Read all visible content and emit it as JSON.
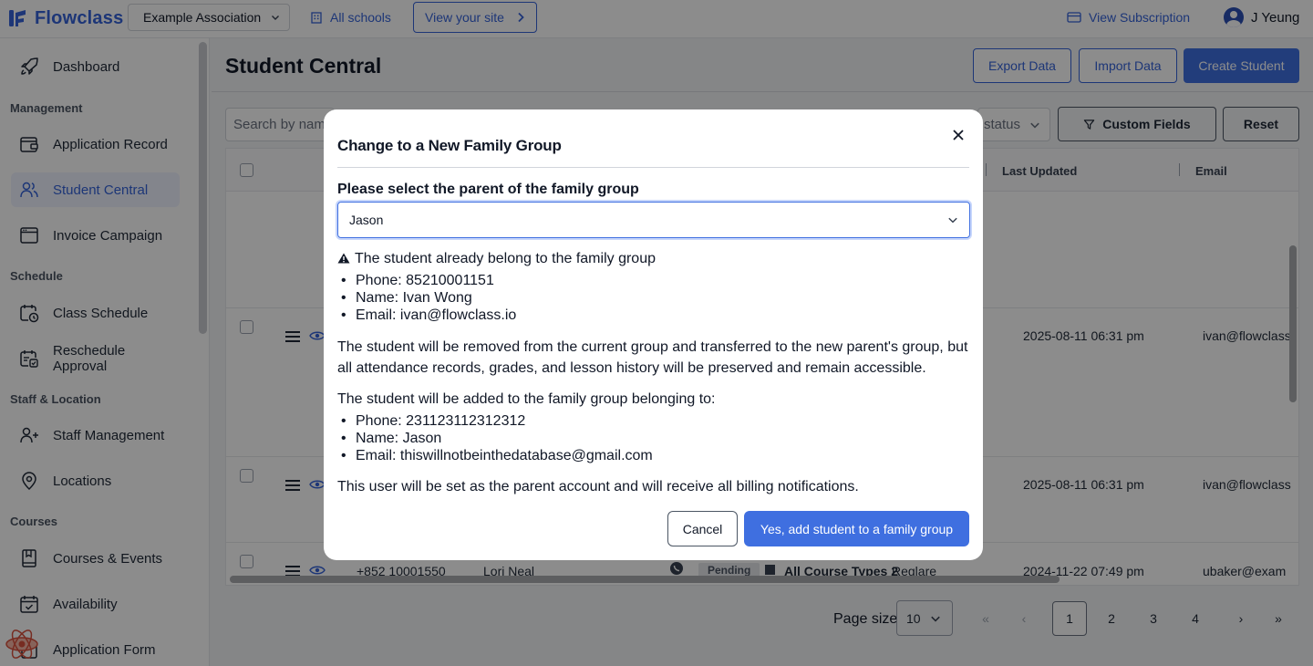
{
  "topbar": {
    "logo_text": "Flowclass",
    "association": "Example Association",
    "all_schools": "All schools",
    "view_site": "View your site",
    "view_subscription": "View Subscription",
    "user_name": "J Yeung"
  },
  "sidebar": {
    "items": [
      {
        "label": "Dashboard",
        "icon": "rocket-icon"
      },
      {
        "label": "Application Record",
        "icon": "wallet-icon"
      },
      {
        "label": "Student Central",
        "icon": "users-icon",
        "active": true
      },
      {
        "label": "Invoice Campaign",
        "icon": "browser-icon"
      },
      {
        "label": "Class Schedule",
        "icon": "calendar-clock-icon"
      },
      {
        "label": "Reschedule Approval",
        "icon": "calendar-list-icon"
      },
      {
        "label": "Staff Management",
        "icon": "user-plus-icon"
      },
      {
        "label": "Locations",
        "icon": "location-pin-icon"
      },
      {
        "label": "Courses & Events",
        "icon": "bookmark-book-icon"
      },
      {
        "label": "Availability",
        "icon": "calendar-check-icon"
      },
      {
        "label": "Application Form",
        "icon": "form-icon"
      }
    ],
    "sections": [
      "Management",
      "Schedule",
      "Staff & Location",
      "Courses"
    ]
  },
  "main": {
    "title": "Student Central",
    "export_label": "Export Data",
    "import_label": "Import Data",
    "create_label": "Create Student",
    "search_placeholder": "Search by name",
    "status_placeholder": "status",
    "custom_fields_label": "Custom Fields",
    "reset_label": "Reset",
    "columns": {
      "last_updated": "Last Updated",
      "email": "Email"
    },
    "rows": [
      {
        "updated": "2025-08-11 06:31 pm",
        "email": "ivan@flowclass"
      },
      {
        "updated": "2025-08-11 06:31 pm",
        "email": "ivan@flowclass"
      },
      {
        "phone": "+852 10001550",
        "name": "Lori Neal",
        "status": "Pending",
        "course": "All Course Types 2",
        "course_extra": "Reglare",
        "updated": "2024-11-22 07:49 pm",
        "email": "ubaker@exam"
      }
    ]
  },
  "pagination": {
    "page_size_label": "Page size",
    "page_size": "10",
    "first": "«",
    "prev": "‹",
    "pages": [
      "1",
      "2",
      "3",
      "4"
    ],
    "current": "1",
    "next": "›",
    "last": "»"
  },
  "modal": {
    "title": "Change to a New Family Group",
    "field_label": "Please select the parent of the family group",
    "selected_parent": "Jason",
    "warning": "The student already belong to the family group",
    "current_group": [
      "Phone: 85210001151",
      "Name: Ivan Wong",
      "Email: ivan@flowclass.io"
    ],
    "transfer_line1": "The student will be removed from the current group and transferred to the new parent's group, but",
    "transfer_line2": "all attendance records, grades, and lesson history will be preserved and remain accessible.",
    "added_intro": "The student will be added to the family group belonging to:",
    "new_group": [
      "Phone: 231123112312312",
      "Name: Jason",
      "Email: thiswillnotbeinthedatabase@gmail.com"
    ],
    "parent_note": "This user will be set as the parent account and will receive all billing notifications.",
    "cancel_label": "Cancel",
    "confirm_label": "Yes, add student to a family group"
  },
  "colors": {
    "accent": "#3f6fe0",
    "brand": "#3563d9",
    "overlay": "rgba(0,0,0,0.45)"
  }
}
